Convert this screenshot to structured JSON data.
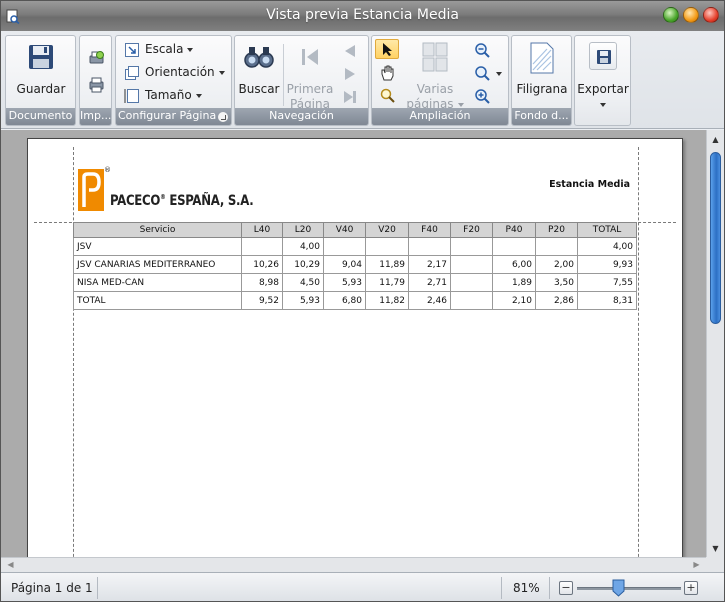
{
  "window": {
    "title": "Vista previa Estancia Media"
  },
  "ribbon": {
    "documento": {
      "label": "Documento",
      "save": "Guardar"
    },
    "imprimir": {
      "label": "Imp..."
    },
    "configurar": {
      "label": "Configurar Página",
      "escala": "Escala",
      "orientacion": "Orientación",
      "tamano": "Tamaño"
    },
    "navegacion": {
      "label": "Navegación",
      "buscar": "Buscar",
      "primera_1": "Primera",
      "primera_2": "Página"
    },
    "ampliacion": {
      "label": "Ampliación",
      "varias_1": "Varias",
      "varias_2": "páginas"
    },
    "fondo": {
      "label": "Fondo d...",
      "filigrana": "Filigrana"
    },
    "exportar": {
      "label": "Exportar"
    }
  },
  "report": {
    "company": "PACECO",
    "company_rest": " ESPAÑA, S.A.",
    "reg_mark": "®",
    "title": "Estancia Media",
    "columns": [
      "Servicio",
      "L40",
      "L20",
      "V40",
      "V20",
      "F40",
      "F20",
      "P40",
      "P20",
      "TOTAL"
    ],
    "rows": [
      [
        "JSV",
        "",
        "4,00",
        "",
        "",
        "",
        "",
        "",
        "",
        "4,00"
      ],
      [
        "JSV CANARIAS MEDITERRANEO",
        "10,26",
        "10,29",
        "9,04",
        "11,89",
        "2,17",
        "",
        "6,00",
        "2,00",
        "9,93"
      ],
      [
        "NISA MED-CAN",
        "8,98",
        "4,50",
        "5,93",
        "11,79",
        "2,71",
        "",
        "1,89",
        "3,50",
        "7,55"
      ],
      [
        "TOTAL",
        "9,52",
        "5,93",
        "6,80",
        "11,82",
        "2,46",
        "",
        "2,10",
        "2,86",
        "8,31"
      ]
    ]
  },
  "status": {
    "page": "Página 1 de 1",
    "zoom": "81%",
    "zoom_minus": "−",
    "zoom_plus": "+",
    "zoom_level_percent": 81
  },
  "colors": {
    "logo_orange": "#f08a00",
    "scroll_blue": "#2c6fc4"
  }
}
